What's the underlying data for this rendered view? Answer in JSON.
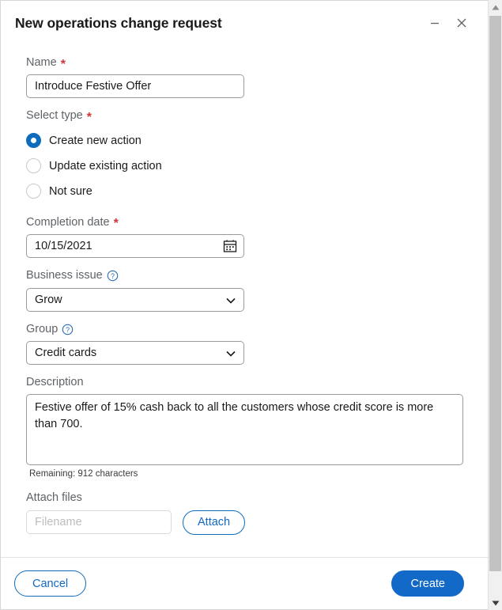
{
  "window": {
    "title": "New operations change request",
    "minimize_icon": "minimize-icon",
    "close_icon": "close-icon"
  },
  "form": {
    "name": {
      "label": "Name",
      "required_marker": "*",
      "value": "Introduce Festive Offer",
      "placeholder": ""
    },
    "select_type": {
      "label": "Select type",
      "required_marker": "*",
      "options": [
        {
          "label": "Create new action",
          "checked": true
        },
        {
          "label": "Update existing action",
          "checked": false
        },
        {
          "label": "Not sure",
          "checked": false
        }
      ]
    },
    "completion_date": {
      "label": "Completion date",
      "required_marker": "*",
      "value": "10/15/2021",
      "icon": "calendar-icon"
    },
    "business_issue": {
      "label": "Business issue",
      "help_icon": "help-circle-icon",
      "value": "Grow"
    },
    "group": {
      "label": "Group",
      "help_icon": "help-circle-icon",
      "value": "Credit cards"
    },
    "description": {
      "label": "Description",
      "value": "Festive offer of 15% cash back to all the customers whose credit score is more than 700.",
      "remaining_text": "Remaining: 912 characters"
    },
    "attach_files": {
      "label": "Attach files",
      "filename_placeholder": "Filename",
      "filename_value": "",
      "attach_button": "Attach"
    }
  },
  "footer": {
    "cancel_label": "Cancel",
    "create_label": "Create"
  },
  "scrollbar": {
    "up_arrow": "scroll-up-arrow-icon",
    "down_arrow": "scroll-down-arrow-icon"
  },
  "colors": {
    "accent_blue": "#1269c7",
    "link_blue": "#0f6cbd",
    "required_red": "#d13438",
    "label_gray": "#5f6368",
    "text_dark": "#1a1a1a"
  }
}
